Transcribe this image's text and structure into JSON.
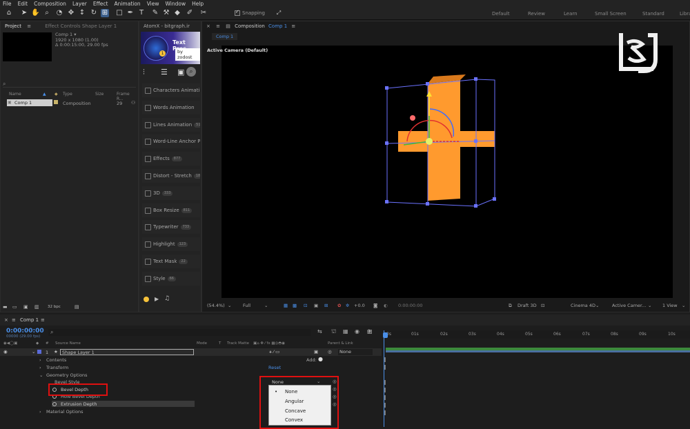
{
  "menu": [
    "File",
    "Edit",
    "Composition",
    "Layer",
    "Effect",
    "Animation",
    "View",
    "Window",
    "Help"
  ],
  "toolbar": {
    "snapping_label": "Snapping",
    "workspaces": [
      "Default",
      "Review",
      "Learn",
      "Small Screen",
      "Standard",
      "Libraries"
    ]
  },
  "project_panel": {
    "tab_project": "Project",
    "tab_effect_controls": "Effect Controls Shape Layer 1",
    "comp_name": "Comp 1 ▾",
    "comp_size": "1920 x 1080 (1.00)",
    "comp_duration": "Δ 0:00:15:00, 29.00 fps",
    "columns": [
      "Name",
      "Type",
      "Size",
      "Frame R..."
    ],
    "row": {
      "name": "Comp 1",
      "type": "Composition",
      "frame_rate": "29"
    },
    "bpc": "32 bpc"
  },
  "atomx": {
    "tab": "AtomX - bitgraph.ir",
    "banner_title": "Text Pres",
    "banner_sub": "by zodost",
    "items": [
      {
        "label": "Characters Animati",
        "badge": ""
      },
      {
        "label": "Words Animation",
        "badge": ""
      },
      {
        "label": "Lines Animation",
        "badge": "51"
      },
      {
        "label": "Word-Line Anchor P",
        "badge": ""
      },
      {
        "label": "Effects",
        "badge": "877"
      },
      {
        "label": "Distort - Stretch",
        "badge": "18"
      },
      {
        "label": "3D",
        "badge": "333"
      },
      {
        "label": "Box Resize",
        "badge": "811"
      },
      {
        "label": "Typewriter",
        "badge": "733"
      },
      {
        "label": "Highlight",
        "badge": "123"
      },
      {
        "label": "Text Mask",
        "badge": "22"
      },
      {
        "label": "Style",
        "badge": "66"
      }
    ]
  },
  "composition_panel": {
    "tab_prefix": "Composition",
    "tab_comp": "Comp 1",
    "subtab": "Comp 1",
    "camera_label": "Active Camera (Default)",
    "bottom": {
      "zoom": "(54.4%)",
      "resolution": "Full",
      "exposure": "+0.0",
      "time": "0:00:00:00",
      "draft": "Draft 3D",
      "renderer": "Cinema 4D",
      "camera": "Active Camer...",
      "views": "1 View"
    }
  },
  "timeline": {
    "tab": "Comp 1",
    "timecode": "0:00:00:00",
    "fps": "00000 (29.00 fps)",
    "ruler": [
      "0s",
      "01s",
      "02s",
      "03s",
      "04s",
      "05s",
      "06s",
      "07s",
      "08s",
      "09s",
      "10s"
    ],
    "headers": {
      "source": "Source Name",
      "mode": "Mode",
      "t": "T",
      "track_matte": "Track Matte",
      "parent": "Parent & Link"
    },
    "layer": {
      "index": "1",
      "name": "Shape Layer 1",
      "parent": "None"
    },
    "add_label": "Add:",
    "reset_label": "Reset",
    "properties": {
      "contents": "Contents",
      "transform": "Transform",
      "geometry": "Geometry Options",
      "bevel_style": "Bevel Style",
      "bevel_depth": "Bevel Depth",
      "hole_bevel": "Hole Bevel Depth",
      "extrusion": "Extrusion Depth",
      "material": "Material Options"
    },
    "bevel_style_value": "None",
    "dropdown": [
      "None",
      "Angular",
      "Concave",
      "Convex"
    ]
  },
  "colors": {
    "accent_blue": "#4a8fe8",
    "shape_orange": "#ff9a2e",
    "highlight_red": "#e01010"
  }
}
